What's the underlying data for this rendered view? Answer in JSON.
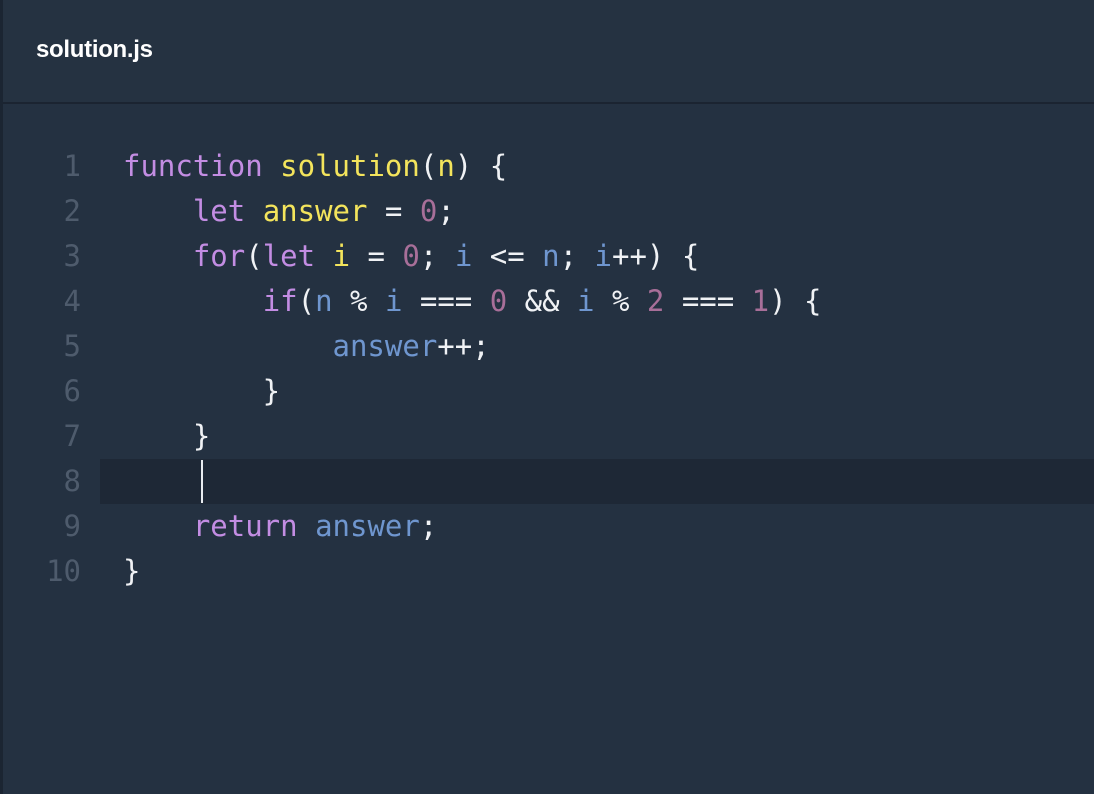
{
  "tab": {
    "filename": "solution.js"
  },
  "editor": {
    "active_line": 8,
    "lines": [
      {
        "n": "1",
        "tokens": [
          {
            "t": "function",
            "c": "kw"
          },
          {
            "t": " ",
            "c": "pn"
          },
          {
            "t": "solution",
            "c": "fn"
          },
          {
            "t": "(",
            "c": "pn"
          },
          {
            "t": "n",
            "c": "fn"
          },
          {
            "t": ") {",
            "c": "pn"
          }
        ]
      },
      {
        "n": "2",
        "tokens": [
          {
            "t": "    ",
            "c": "pn"
          },
          {
            "t": "let",
            "c": "kw"
          },
          {
            "t": " ",
            "c": "pn"
          },
          {
            "t": "answer",
            "c": "fn"
          },
          {
            "t": " = ",
            "c": "pn"
          },
          {
            "t": "0",
            "c": "num"
          },
          {
            "t": ";",
            "c": "pn"
          }
        ]
      },
      {
        "n": "3",
        "tokens": [
          {
            "t": "    ",
            "c": "pn"
          },
          {
            "t": "for",
            "c": "kw"
          },
          {
            "t": "(",
            "c": "pn"
          },
          {
            "t": "let",
            "c": "kw"
          },
          {
            "t": " ",
            "c": "pn"
          },
          {
            "t": "i",
            "c": "fn"
          },
          {
            "t": " = ",
            "c": "pn"
          },
          {
            "t": "0",
            "c": "num"
          },
          {
            "t": "; ",
            "c": "pn"
          },
          {
            "t": "i",
            "c": "nm"
          },
          {
            "t": " <= ",
            "c": "pn"
          },
          {
            "t": "n",
            "c": "nm"
          },
          {
            "t": "; ",
            "c": "pn"
          },
          {
            "t": "i",
            "c": "nm"
          },
          {
            "t": "++) {",
            "c": "pn"
          }
        ]
      },
      {
        "n": "4",
        "tokens": [
          {
            "t": "        ",
            "c": "pn"
          },
          {
            "t": "if",
            "c": "kw"
          },
          {
            "t": "(",
            "c": "pn"
          },
          {
            "t": "n",
            "c": "nm"
          },
          {
            "t": " % ",
            "c": "pn"
          },
          {
            "t": "i",
            "c": "nm"
          },
          {
            "t": " === ",
            "c": "pn"
          },
          {
            "t": "0",
            "c": "num"
          },
          {
            "t": " && ",
            "c": "pn"
          },
          {
            "t": "i",
            "c": "nm"
          },
          {
            "t": " % ",
            "c": "pn"
          },
          {
            "t": "2",
            "c": "num"
          },
          {
            "t": " === ",
            "c": "pn"
          },
          {
            "t": "1",
            "c": "num"
          },
          {
            "t": ") {",
            "c": "pn"
          }
        ]
      },
      {
        "n": "5",
        "tokens": [
          {
            "t": "            ",
            "c": "pn"
          },
          {
            "t": "answer",
            "c": "nm"
          },
          {
            "t": "++;",
            "c": "pn"
          }
        ]
      },
      {
        "n": "6",
        "tokens": [
          {
            "t": "        }",
            "c": "pn"
          }
        ]
      },
      {
        "n": "7",
        "tokens": [
          {
            "t": "    }",
            "c": "pn"
          }
        ]
      },
      {
        "n": "8",
        "tokens": []
      },
      {
        "n": "9",
        "tokens": [
          {
            "t": "    ",
            "c": "pn"
          },
          {
            "t": "return",
            "c": "kw"
          },
          {
            "t": " ",
            "c": "pn"
          },
          {
            "t": "answer",
            "c": "nm"
          },
          {
            "t": ";",
            "c": "pn"
          }
        ]
      },
      {
        "n": "10",
        "tokens": [
          {
            "t": "}",
            "c": "pn"
          }
        ]
      }
    ]
  }
}
